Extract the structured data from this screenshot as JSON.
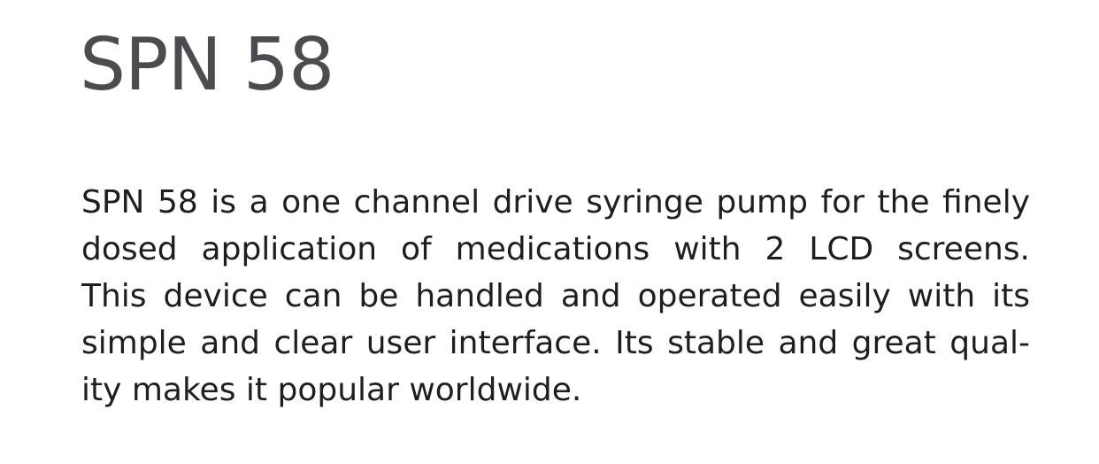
{
  "document": {
    "title": "SPN 58",
    "description_lines": [
      "SPN 58 is a one channel drive syringe pump for the finely",
      "dosed application of medications with 2 LCD screens.",
      "This device can be handled and operated easily with its",
      "simple and clear user interface. Its stable and great qual-",
      "ity makes it popular worldwide."
    ]
  },
  "colors": {
    "title": "#4a4c4f",
    "text": "#1e1e1e",
    "background": "#ffffff"
  }
}
